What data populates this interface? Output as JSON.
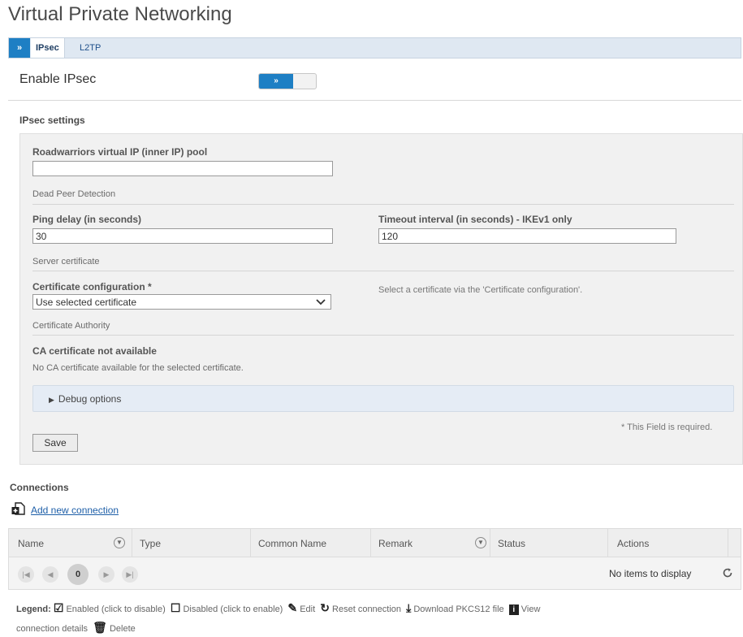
{
  "page": {
    "title": "Virtual Private Networking"
  },
  "tabs": {
    "arrow": "»",
    "items": [
      "IPsec",
      "L2TP"
    ],
    "active": "IPsec"
  },
  "enable": {
    "label": "Enable IPsec",
    "toggle_text": "»",
    "enabled": true
  },
  "ipsec_settings": {
    "heading": "IPsec settings",
    "pool": {
      "label": "Roadwarriors virtual IP (inner IP) pool",
      "value": ""
    },
    "dpd": {
      "heading": "Dead Peer Detection",
      "ping_delay": {
        "label": "Ping delay (in seconds)",
        "value": "30"
      },
      "timeout": {
        "label": "Timeout interval (in seconds) - IKEv1 only",
        "value": "120"
      }
    },
    "server_cert": {
      "heading": "Server certificate",
      "config_label": "Certificate configuration *",
      "config_value": "Use selected certificate",
      "hint": "Select a certificate via the 'Certificate configuration'."
    },
    "ca": {
      "heading": "Certificate Authority",
      "status_title": "CA certificate not available",
      "status_text": "No CA certificate available for the selected certificate."
    },
    "debug": {
      "label": "Debug options"
    },
    "required_note": "* This Field is required.",
    "save_label": "Save"
  },
  "connections": {
    "heading": "Connections",
    "add_label": "Add new connection",
    "columns": [
      "Name",
      "Type",
      "Common Name",
      "Remark",
      "Status",
      "Actions"
    ],
    "pager": {
      "page": "0",
      "empty_text": "No items to display"
    }
  },
  "legend": {
    "label": "Legend:",
    "enabled": "Enabled (click to disable)",
    "disabled": "Disabled (click to enable)",
    "edit": "Edit",
    "reset": "Reset connection",
    "download": "Download PKCS12 file",
    "view_line1": "View",
    "view_line2": "connection details",
    "delete": "Delete"
  },
  "colors": {
    "accent": "#1e7fc4",
    "tab_bg": "#dfe8f2",
    "panel_bg": "#f1f1f1",
    "link": "#1e5fa8"
  },
  "icons": [
    "chevron-right-icon",
    "dropdown-chevron-icon",
    "triangle-right-icon",
    "add-connection-icon",
    "filter-icon",
    "first-page-icon",
    "prev-page-icon",
    "next-page-icon",
    "last-page-icon",
    "refresh-icon",
    "checkbox-checked-icon",
    "checkbox-empty-icon",
    "pencil-icon",
    "reset-icon",
    "download-icon",
    "info-icon",
    "trash-icon"
  ]
}
